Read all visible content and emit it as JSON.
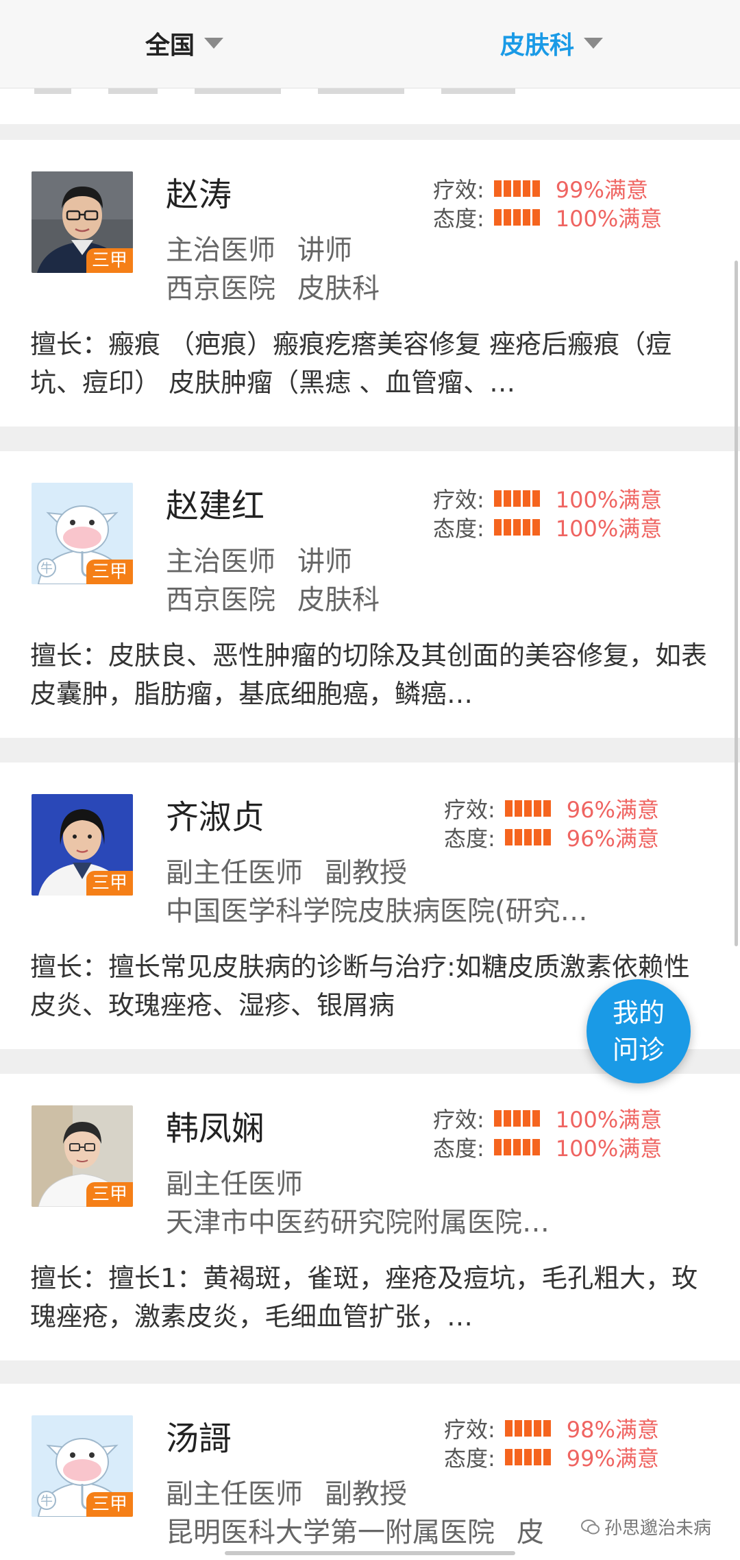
{
  "filters": {
    "region": "全国",
    "department": "皮肤科"
  },
  "rating_labels": {
    "efficacy": "疗效:",
    "attitude": "态度:"
  },
  "doctors": [
    {
      "name": "赵涛",
      "title": "主治医师",
      "academic": "讲师",
      "hospital": "西京医院",
      "dept": "皮肤科",
      "badge": "三甲",
      "efficacy": "99%满意",
      "attitude": "100%满意",
      "specialty": "擅长：瘢痕 （疤痕）瘢痕疙瘩美容修复 痤疮后瘢痕（痘坑、痘印） 皮肤肿瘤（黑痣 、血管瘤、…"
    },
    {
      "name": "赵建红",
      "title": "主治医师",
      "academic": "讲师",
      "hospital": "西京医院",
      "dept": "皮肤科",
      "badge": "三甲",
      "efficacy": "100%满意",
      "attitude": "100%满意",
      "specialty": "擅长：皮肤良、恶性肿瘤的切除及其创面的美容修复，如表皮囊肿，脂肪瘤，基底细胞癌，鳞癌…"
    },
    {
      "name": "齐淑贞",
      "title": "副主任医师",
      "academic": "副教授",
      "hospital": "中国医学科学院皮肤病医院(研究…",
      "dept": "",
      "badge": "三甲",
      "efficacy": "96%满意",
      "attitude": "96%满意",
      "specialty": "擅长：擅长常见皮肤病的诊断与治疗:如糖皮质激素依赖性皮炎、玫瑰痤疮、湿疹、银屑病"
    },
    {
      "name": "韩凤娴",
      "title": "副主任医师",
      "academic": "",
      "hospital": "天津市中医药研究院附属医院…",
      "dept": "",
      "badge": "三甲",
      "efficacy": "100%满意",
      "attitude": "100%满意",
      "specialty": "擅长：擅长1：黄褐斑，雀斑，痤疮及痘坑，毛孔粗大，玫瑰痤疮，激素皮炎，毛细血管扩张，…"
    },
    {
      "name": "汤謌",
      "title": "副主任医师",
      "academic": "副教授",
      "hospital": "昆明医科大学第一附属医院",
      "dept": "皮",
      "badge": "三甲",
      "efficacy": "98%满意",
      "attitude": "99%满意",
      "specialty": ""
    }
  ],
  "fab": {
    "line1": "我的",
    "line2": "问诊"
  },
  "watermark": "孙思邈治未病",
  "colors": {
    "accent": "#1a9ae6",
    "bar": "#f5641e",
    "satisfaction": "#ef6461",
    "badge": "#f57f17"
  }
}
